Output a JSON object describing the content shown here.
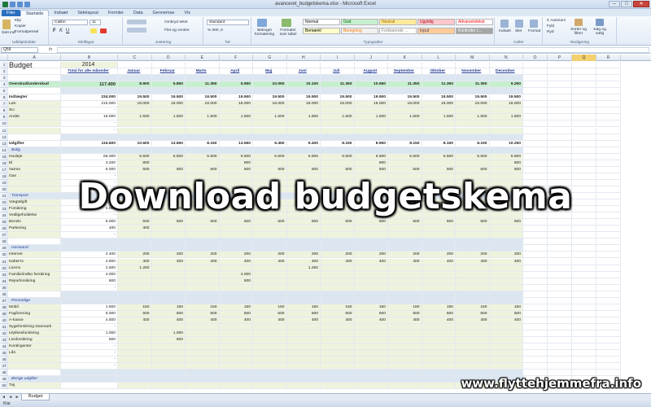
{
  "window": {
    "title": "avanceret_budgetskema.xlsx - Microsoft Excel",
    "buttons": [
      "–",
      "□",
      "✕"
    ]
  },
  "tabs": [
    "Filer",
    "Startside",
    "Indsæt",
    "Sidelayout",
    "Formler",
    "Data",
    "Gennemse",
    "Vis"
  ],
  "ribbon": {
    "clipboard": {
      "paste": "Sæt ind",
      "cut": "Klip",
      "copy": "Kopier",
      "format_painter": "Formatpensel",
      "label": "Udklipsholder"
    },
    "font": {
      "name": "Calibri",
      "size": "11",
      "label": "Skrifttype"
    },
    "alignment": {
      "wrap": "Ombryd tekst",
      "merge": "Flet og centrer",
      "label": "Justering"
    },
    "number": {
      "format": "Standard",
      "label": "Tal"
    },
    "styles": {
      "conditional": "Betinget formatering",
      "table": "Formater som tabel",
      "cells": [
        {
          "text": "Normal",
          "bg": "#ffffff",
          "fg": "#000000"
        },
        {
          "text": "God",
          "bg": "#c6efce",
          "fg": "#006100"
        },
        {
          "text": "Neutral",
          "bg": "#ffeb9c",
          "fg": "#9c6500"
        },
        {
          "text": "Ugyldig",
          "bg": "#ffc7ce",
          "fg": "#9c0006"
        },
        {
          "text": "Advarselstekst",
          "bg": "#ffffff",
          "fg": "#ff0000"
        },
        {
          "text": "Bemærk!",
          "bg": "#ffffcc",
          "fg": "#000000"
        },
        {
          "text": "Beregning",
          "bg": "#f2f2f2",
          "fg": "#fa7d00"
        },
        {
          "text": "Forklarende ...",
          "bg": "#ffffff",
          "fg": "#7f7f7f"
        },
        {
          "text": "Input",
          "bg": "#ffcc99",
          "fg": "#3f3f76"
        },
        {
          "text": "Kontroller c...",
          "bg": "#a5a5a5",
          "fg": "#ffffff"
        }
      ],
      "label": "Typografier"
    },
    "cellsgrp": {
      "insert": "Indsæt",
      "delete": "Slet",
      "format": "Format",
      "label": "Celler"
    },
    "editing": {
      "autosum": "Autosum",
      "fill": "Fyld",
      "clear": "Ryd",
      "sort": "Sorter og filtrer",
      "find": "Søg og vælg",
      "label": "Redigering"
    }
  },
  "formula_bar": {
    "name_box": "Q59",
    "fx": "fx",
    "formula": ""
  },
  "columns": [
    "A",
    "B",
    "C",
    "D",
    "E",
    "F",
    "G",
    "H",
    "I",
    "J",
    "K",
    "L",
    "M",
    "N",
    "O",
    "P",
    "Q",
    "R"
  ],
  "selected_column": "Q",
  "sheet": {
    "title": "Budget",
    "year": "2014",
    "month_headers": [
      "Total for alle måneder",
      "Januar",
      "Februar",
      "Marts",
      "April",
      "Maj",
      "Juni",
      "Juli",
      "August",
      "September",
      "Oktober",
      "November",
      "December"
    ],
    "rows": [
      {
        "n": "1",
        "kind": "title"
      },
      {
        "n": "2",
        "kind": "months"
      },
      {
        "n": "3",
        "kind": "blank"
      },
      {
        "n": "4",
        "kind": "surplus",
        "label": "Overskud/underskud",
        "vals": [
          "117.400",
          "8.900",
          "5.850",
          "11.350",
          "5.950",
          "10.050",
          "10.100",
          "11.350",
          "10.550",
          "11.350",
          "11.350",
          "11.350",
          "9.250"
        ]
      },
      {
        "n": "5",
        "kind": "blank"
      },
      {
        "n": "6",
        "kind": "total",
        "label": "Indtægter",
        "vals": [
          "234.000",
          "19.500",
          "19.500",
          "19.500",
          "19.500",
          "19.500",
          "19.500",
          "19.500",
          "19.500",
          "19.500",
          "19.500",
          "19.500",
          "19.500"
        ]
      },
      {
        "n": "7",
        "kind": "item",
        "label": "Løn",
        "vals": [
          "216.000",
          "18.000",
          "18.000",
          "18.000",
          "18.000",
          "18.000",
          "18.000",
          "18.000",
          "18.000",
          "18.000",
          "18.000",
          "18.000",
          "18.000"
        ]
      },
      {
        "n": "8",
        "kind": "item",
        "label": "SU",
        "vals": [
          "-"
        ]
      },
      {
        "n": "9",
        "kind": "item",
        "label": "Andet",
        "vals": [
          "18.000",
          "1.500",
          "1.500",
          "1.500",
          "1.500",
          "1.500",
          "1.500",
          "1.500",
          "1.500",
          "1.500",
          "1.500",
          "1.500",
          "1.500"
        ]
      },
      {
        "n": "10",
        "kind": "item",
        "label": "",
        "vals": [
          "-"
        ]
      },
      {
        "n": "11",
        "kind": "item",
        "label": "",
        "vals": [
          "-"
        ]
      },
      {
        "n": "12",
        "kind": "blank"
      },
      {
        "n": "13",
        "kind": "total",
        "label": "Udgifter",
        "vals": [
          "116.600",
          "10.600",
          "13.650",
          "8.150",
          "13.550",
          "9.450",
          "9.400",
          "8.150",
          "8.950",
          "8.150",
          "8.150",
          "8.150",
          "10.250"
        ]
      },
      {
        "n": "14",
        "kind": "cat",
        "label": "Bolig"
      },
      {
        "n": "15",
        "kind": "item",
        "label": "Husleje",
        "vals": [
          "66.000",
          "5.500",
          "5.500",
          "5.500",
          "5.500",
          "5.500",
          "5.500",
          "5.500",
          "5.500",
          "5.500",
          "5.500",
          "5.500",
          "5.500"
        ]
      },
      {
        "n": "16",
        "kind": "item",
        "label": "El",
        "vals": [
          "3.200",
          "800",
          "",
          "",
          "800",
          "",
          "",
          "",
          "800",
          "",
          "",
          "",
          "800"
        ]
      },
      {
        "n": "17",
        "kind": "item",
        "label": "Varme",
        "vals": [
          "6.000",
          "500",
          "500",
          "500",
          "500",
          "500",
          "500",
          "500",
          "500",
          "500",
          "500",
          "500",
          "500"
        ]
      },
      {
        "n": "18",
        "kind": "item",
        "label": "Gas",
        "vals": [
          "-"
        ]
      },
      {
        "n": "19",
        "kind": "item",
        "label": "",
        "vals": [
          "-"
        ]
      },
      {
        "n": "20",
        "kind": "item",
        "label": "",
        "vals": [
          "-"
        ]
      },
      {
        "n": "21",
        "kind": "cat",
        "label": "Transport"
      },
      {
        "n": "22",
        "kind": "item",
        "label": "Vægtafgift",
        "vals": [
          "1.600",
          "",
          "",
          "",
          "",
          "",
          "800"
        ]
      },
      {
        "n": "23",
        "kind": "item",
        "label": "Forsikring",
        "vals": [
          "4.000",
          "",
          "4.000"
        ]
      },
      {
        "n": "24",
        "kind": "item",
        "label": "Vedligeholdelse",
        "vals": [
          "-"
        ]
      },
      {
        "n": "25",
        "kind": "item",
        "label": "Benzin",
        "vals": [
          "6.000",
          "500",
          "500",
          "500",
          "500",
          "500",
          "500",
          "500",
          "500",
          "500",
          "500",
          "500",
          "500"
        ]
      },
      {
        "n": "26",
        "kind": "item",
        "label": "Parkering",
        "vals": [
          "400",
          "400"
        ]
      },
      {
        "n": "27",
        "kind": "item",
        "label": "",
        "vals": [
          "-"
        ]
      },
      {
        "n": "28",
        "kind": "blank"
      },
      {
        "n": "29",
        "kind": "cat",
        "label": "Husstand"
      },
      {
        "n": "30",
        "kind": "item",
        "label": "Internet",
        "vals": [
          "2.400",
          "200",
          "200",
          "200",
          "200",
          "200",
          "200",
          "200",
          "200",
          "200",
          "200",
          "200",
          "200"
        ]
      },
      {
        "n": "31",
        "kind": "item",
        "label": "Kabel-tv",
        "vals": [
          "4.800",
          "400",
          "400",
          "400",
          "400",
          "400",
          "400",
          "400",
          "400",
          "400",
          "400",
          "400",
          "400"
        ]
      },
      {
        "n": "32",
        "kind": "item",
        "label": "Licens",
        "vals": [
          "2.500",
          "1.250",
          "",
          "",
          "",
          "",
          "1.250"
        ]
      },
      {
        "n": "33",
        "kind": "item",
        "label": "Familie/indbo forsikring",
        "vals": [
          "4.000",
          "",
          "",
          "",
          "4.000"
        ]
      },
      {
        "n": "34",
        "kind": "item",
        "label": "Rejseforsikring",
        "vals": [
          "600",
          "",
          "",
          "",
          "600"
        ]
      },
      {
        "n": "35",
        "kind": "item",
        "label": "",
        "vals": [
          "-"
        ]
      },
      {
        "n": "36",
        "kind": "blank"
      },
      {
        "n": "37",
        "kind": "cat",
        "label": "Personlige"
      },
      {
        "n": "38",
        "kind": "item",
        "label": "Mobil",
        "vals": [
          "1.800",
          "150",
          "150",
          "150",
          "150",
          "150",
          "150",
          "150",
          "150",
          "150",
          "150",
          "150",
          "150"
        ]
      },
      {
        "n": "39",
        "kind": "item",
        "label": "Fagforening",
        "vals": [
          "6.000",
          "500",
          "500",
          "500",
          "500",
          "500",
          "500",
          "500",
          "500",
          "500",
          "500",
          "500",
          "500"
        ]
      },
      {
        "n": "40",
        "kind": "item",
        "label": "A-kasse",
        "vals": [
          "4.800",
          "400",
          "400",
          "400",
          "400",
          "400",
          "400",
          "400",
          "400",
          "400",
          "400",
          "400",
          "400"
        ]
      },
      {
        "n": "41",
        "kind": "item",
        "label": "Sygeforsikring Danmark",
        "vals": [
          "-"
        ]
      },
      {
        "n": "42",
        "kind": "item",
        "label": "Ulykkesforsikring",
        "vals": [
          "1.000",
          "",
          "1.000"
        ]
      },
      {
        "n": "43",
        "kind": "item",
        "label": "Livsforsikring",
        "vals": [
          "500",
          "",
          "500"
        ]
      },
      {
        "n": "44",
        "kind": "item",
        "label": "Kontingenter",
        "vals": [
          "-"
        ]
      },
      {
        "n": "45",
        "kind": "item",
        "label": "Lån",
        "vals": [
          "-"
        ]
      },
      {
        "n": "46",
        "kind": "item",
        "label": "",
        "vals": [
          "-"
        ]
      },
      {
        "n": "47",
        "kind": "item",
        "label": "",
        "vals": [
          "-"
        ]
      },
      {
        "n": "48",
        "kind": "blank"
      },
      {
        "n": "49",
        "kind": "cat",
        "label": "Øvrige udgifter"
      },
      {
        "n": "50",
        "kind": "item",
        "label": "Tøj",
        "vals": [
          ""
        ]
      }
    ]
  },
  "sheet_tabs": {
    "nav": "◄ ◄ ► ►",
    "active": "Budget"
  },
  "status": "Klar",
  "overlay": {
    "title": "Download budgetskema",
    "url": "www.flyttehjemmefra.info"
  }
}
